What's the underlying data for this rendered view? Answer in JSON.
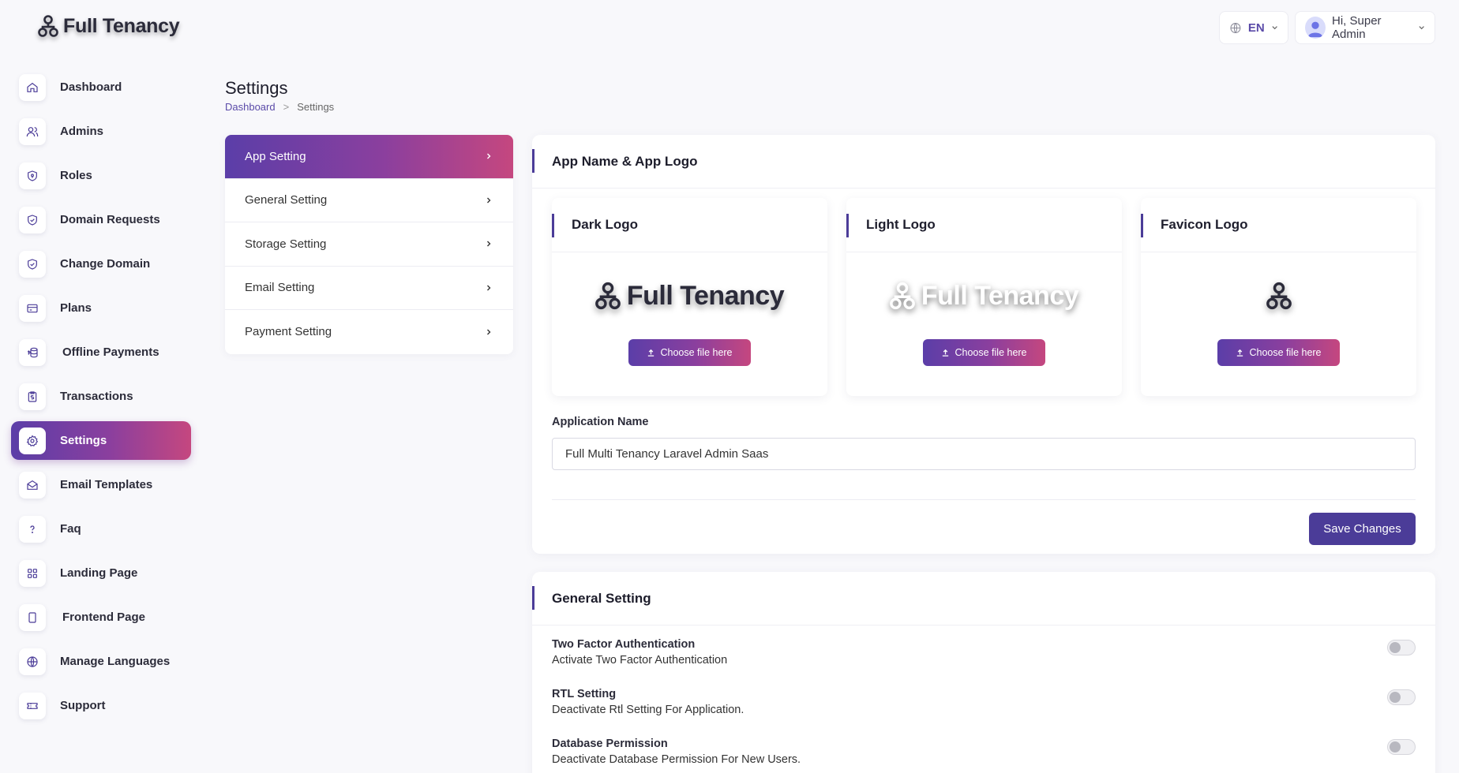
{
  "brand": {
    "name": "Full Tenancy"
  },
  "topbar": {
    "language": "EN",
    "greeting": "Hi, Super Admin"
  },
  "sidebar": {
    "items": [
      {
        "label": "Dashboard",
        "icon": "home-icon"
      },
      {
        "label": "Admins",
        "icon": "users-icon"
      },
      {
        "label": "Roles",
        "icon": "shield-icon"
      },
      {
        "label": "Domain Requests",
        "icon": "shield-check-icon"
      },
      {
        "label": "Change Domain",
        "icon": "shield-check-icon"
      },
      {
        "label": "Plans",
        "icon": "card-icon"
      },
      {
        "label": "Offline Payments",
        "icon": "money-icon"
      },
      {
        "label": "Transactions",
        "icon": "clipboard-icon"
      },
      {
        "label": "Settings",
        "icon": "gear-icon",
        "active": true
      },
      {
        "label": "Email Templates",
        "icon": "mail-open-icon"
      },
      {
        "label": "Faq",
        "icon": "question-icon"
      },
      {
        "label": "Landing Page",
        "icon": "grid-icon"
      },
      {
        "label": "Frontend Page",
        "icon": "tablet-icon"
      },
      {
        "label": "Manage Languages",
        "icon": "globe-icon"
      },
      {
        "label": "Support",
        "icon": "ticket-icon"
      }
    ]
  },
  "page": {
    "title": "Settings",
    "breadcrumb": {
      "home": "Dashboard",
      "separator": ">",
      "current": "Settings"
    }
  },
  "settings_menu": {
    "items": [
      {
        "label": "App Setting",
        "active": true
      },
      {
        "label": "General Setting"
      },
      {
        "label": "Storage Setting"
      },
      {
        "label": "Email Setting"
      },
      {
        "label": "Payment Setting"
      }
    ]
  },
  "app_card": {
    "title": "App Name & App Logo",
    "dark_logo": {
      "title": "Dark Logo",
      "logo_text": "Full Tenancy",
      "button": "Choose file here"
    },
    "light_logo": {
      "title": "Light Logo",
      "logo_text": "Full Tenancy",
      "button": "Choose file here"
    },
    "favicon_logo": {
      "title": "Favicon Logo",
      "button": "Choose file here"
    },
    "app_name_label": "Application Name",
    "app_name_value": "Full Multi Tenancy Laravel Admin Saas",
    "save_label": "Save Changes"
  },
  "general_card": {
    "title": "General Setting",
    "options": [
      {
        "title": "Two Factor Authentication",
        "desc": "Activate Two Factor Authentication",
        "enabled": false
      },
      {
        "title": "RTL Setting",
        "desc": "Deactivate Rtl Setting For Application.",
        "enabled": false
      },
      {
        "title": "Database Permission",
        "desc": "Deactivate Database Permission For New Users.",
        "enabled": false
      }
    ]
  },
  "colors": {
    "accent": "#4b3c98",
    "gradient_start": "#5b3ea8",
    "gradient_end": "#c5477f"
  }
}
